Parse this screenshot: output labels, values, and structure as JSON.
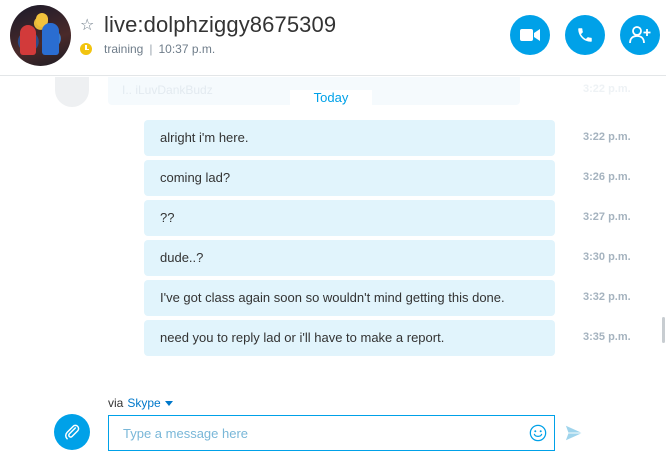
{
  "header": {
    "contact_name": "live:dolphziggy8675309",
    "status_text": "training",
    "separator": "|",
    "local_time": "10:37 p.m.",
    "icons": {
      "favorite": "star-outline-icon",
      "status": "clock-icon",
      "video": "video-camera-icon",
      "audio": "phone-icon",
      "add": "add-person-icon"
    }
  },
  "chat": {
    "ghost_preview": {
      "text": "I.. iLuvDankBudz",
      "time": "3:22 p.m."
    },
    "day_divider": "Today",
    "messages": [
      {
        "text": "alright i'm here.",
        "time": "3:22 p.m."
      },
      {
        "text": "coming lad?",
        "time": "3:26 p.m."
      },
      {
        "text": "??",
        "time": "3:27 p.m."
      },
      {
        "text": "dude..?",
        "time": "3:30 p.m."
      },
      {
        "text": "I've got class again soon so wouldn't mind getting this done.",
        "time": "3:32 p.m."
      },
      {
        "text": "need you to reply lad or i'll have to make a report.",
        "time": "3:35 p.m."
      }
    ]
  },
  "composer": {
    "via_label": "via",
    "via_service": "Skype",
    "placeholder": "Type a message here",
    "value": ""
  },
  "colors": {
    "accent": "#00a1e8",
    "bubble": "#e1f4fc",
    "time_text": "#a5b3bf",
    "status_yellow": "#f2c40f"
  }
}
